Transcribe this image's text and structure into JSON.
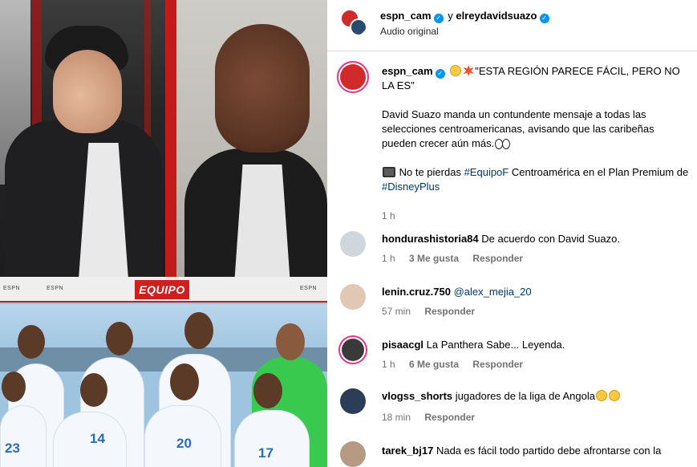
{
  "media": {
    "banner_left_mark": "ESPN",
    "banner_left_mark2": "ESPN",
    "banner_right_mark": "ESPN",
    "banner_logo_text": "EQUIPO F",
    "jersey_numbers": [
      "23",
      "14",
      "20",
      "17"
    ]
  },
  "header": {
    "user1": "espn_cam",
    "connector": "y",
    "user2": "elreydavidsuazo",
    "audio": "Audio original"
  },
  "caption": {
    "username": "espn_cam",
    "line1": "\"ESTA REGIÓN PARECE FÁCIL, PERO NO LA ES\"",
    "para2": "David Suazo manda un contundente mensaje a todas las selecciones centroamericanas, avisando que las caribeñas pueden crecer aún más.",
    "para3_prefix": "No te pierdas",
    "hashtag1": "#EquipoF",
    "para3_mid": "Centroamérica en el Plan Premium de",
    "hashtag2": "#DisneyPlus",
    "time": "1 h"
  },
  "comments": [
    {
      "username": "hondurashistoria84",
      "text": "De acuerdo con David Suazo.",
      "time": "1 h",
      "likes": "3 Me gusta",
      "reply": "Responder"
    },
    {
      "username": "lenin.cruz.750",
      "mention": "@alex_mejia_20",
      "text": "",
      "time": "57 min",
      "likes": "",
      "reply": "Responder"
    },
    {
      "username": "pisaacgl",
      "text": "La Panthera Sabe... Leyenda.",
      "time": "1 h",
      "likes": "6 Me gusta",
      "reply": "Responder"
    },
    {
      "username": "vlogss_shorts",
      "text": "jugadores de la liga de Angola",
      "time": "18 min",
      "likes": "",
      "reply": "Responder"
    },
    {
      "username": "tarek_bj17",
      "text": "Nada es fácil todo partido debe afrontarse con la",
      "time": "",
      "likes": "",
      "reply": ""
    }
  ],
  "colors": {
    "verified": "#0095f6",
    "link": "#00376b",
    "meta": "#737373",
    "story_ring": "#e0338a",
    "espn_red": "#cf1f1f"
  },
  "icons": [
    "verified-badge-icon",
    "flushed-emoji-icon",
    "collision-emoji-icon",
    "eyes-emoji-icon",
    "tv-emoji-icon",
    "laughing-emoji-icon"
  ]
}
